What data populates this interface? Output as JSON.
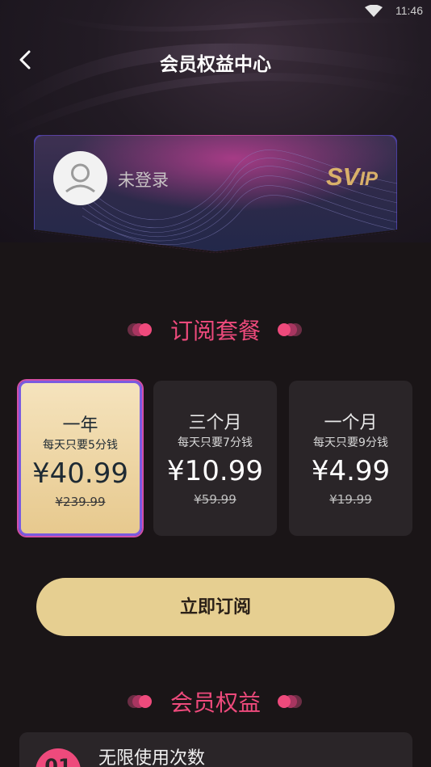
{
  "status_bar": {
    "time": "11:46"
  },
  "header": {
    "title": "会员权益中心"
  },
  "card": {
    "login_status": "未登录",
    "badge_sv": "SV",
    "badge_ip": "IP"
  },
  "sections": {
    "subscribe_title": "订阅套餐",
    "benefits_title": "会员权益"
  },
  "plans": [
    {
      "name": "一年",
      "daily": "每天只要5分钱",
      "price": "¥40.99",
      "original": "¥239.99",
      "selected": true
    },
    {
      "name": "三个月",
      "daily": "每天只要7分钱",
      "price": "¥10.99",
      "original": "¥59.99",
      "selected": false
    },
    {
      "name": "一个月",
      "daily": "每天只要9分钱",
      "price": "¥4.99",
      "original": "¥19.99",
      "selected": false
    }
  ],
  "subscribe_button": "立即订阅",
  "benefits": [
    {
      "number": "01",
      "title": "无限使用次数"
    }
  ],
  "colors": {
    "accent": "#ee4a7c",
    "gold": "#e6cf91",
    "background": "#1a1517",
    "panel": "#2a2528",
    "selected_border": "#7a5be0"
  }
}
